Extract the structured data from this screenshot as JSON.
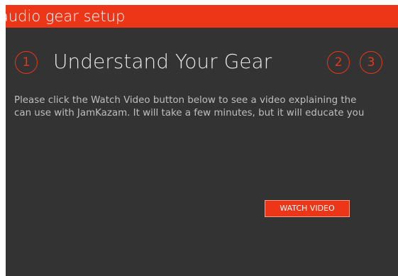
{
  "dialog": {
    "title": "audio gear setup"
  },
  "steps": [
    {
      "number": "1"
    },
    {
      "number": "2"
    },
    {
      "number": "3"
    }
  ],
  "current_step": {
    "heading": "Understand Your Gear",
    "intro_line_1": "Please click the Watch Video button below to see a video explaining the",
    "intro_line_2": "can use with JamKazam. It will take a few minutes, but it will educate you"
  },
  "actions": {
    "watch_video_label": "WATCH VIDEO"
  },
  "colors": {
    "accent": "#ed3618",
    "background": "#333333"
  }
}
